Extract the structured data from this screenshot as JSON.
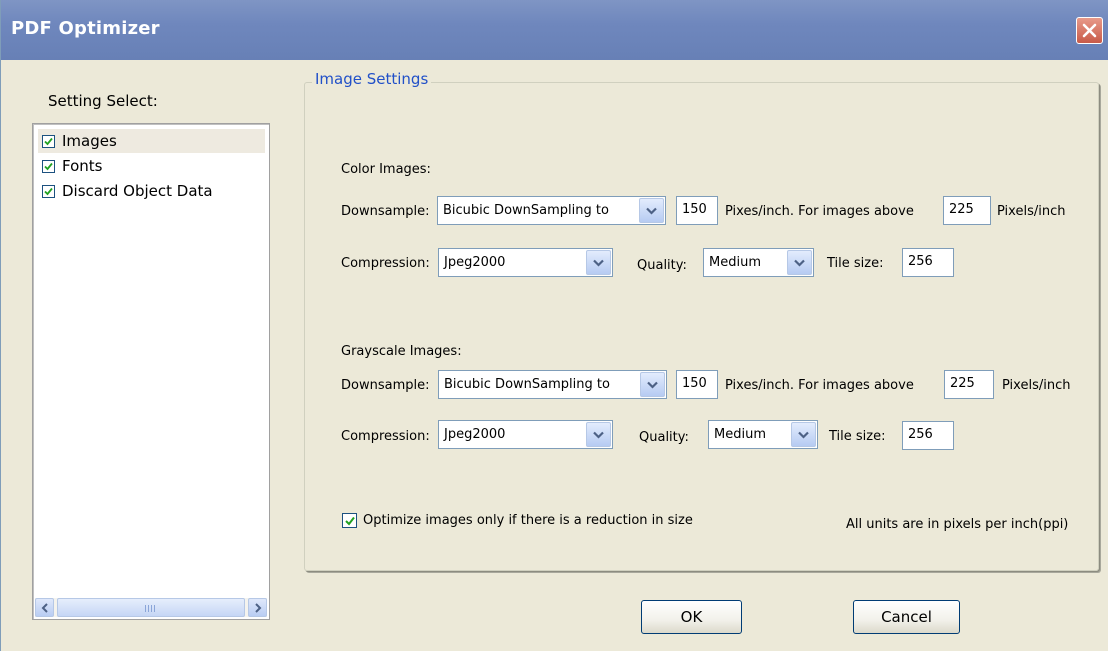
{
  "window": {
    "title": "PDF Optimizer",
    "title_bar_color": "#6f87bd",
    "accent_color": "#2150c8"
  },
  "left_panel": {
    "label": "Setting Select:",
    "items": [
      {
        "label": "Images",
        "checked": true,
        "selected": true
      },
      {
        "label": "Fonts",
        "checked": true,
        "selected": false
      },
      {
        "label": "Discard Object Data",
        "checked": true,
        "selected": false
      }
    ],
    "scrollbar_grip": "|||"
  },
  "image_settings": {
    "title": "Image Settings",
    "color": {
      "heading": "Color Images:",
      "downsample_label": "Downsample:",
      "downsample_value": "Bicubic DownSampling to",
      "ppi_value": "150",
      "ppi_text": "Pixes/inch. For images above",
      "above_value": "225",
      "above_unit": "Pixels/inch",
      "compression_label": "Compression:",
      "compression_value": "Jpeg2000",
      "quality_label": "Quality:",
      "quality_value": "Medium",
      "tile_label": "Tile size:",
      "tile_value": "256"
    },
    "grayscale": {
      "heading": "Grayscale Images:",
      "downsample_label": "Downsample:",
      "downsample_value": "Bicubic DownSampling to",
      "ppi_value": "150",
      "ppi_text": "Pixes/inch. For images above",
      "above_value": "225",
      "above_unit": "Pixels/inch",
      "compression_label": "Compression:",
      "compression_value": "Jpeg2000",
      "quality_label": "Quality:",
      "quality_value": "Medium",
      "tile_label": "Tile size:",
      "tile_value": "256"
    },
    "optimize_label": "Optimize images only if there is a reduction in size",
    "optimize_checked": true,
    "units_note": "All units are in pixels per inch(ppi)"
  },
  "buttons": {
    "ok": "OK",
    "cancel": "Cancel"
  },
  "icons": {
    "close": "close-icon",
    "check": "checkmark-icon",
    "dropdown": "chevron-down-icon",
    "scroll_left": "arrow-left-icon",
    "scroll_right": "arrow-right-icon"
  }
}
